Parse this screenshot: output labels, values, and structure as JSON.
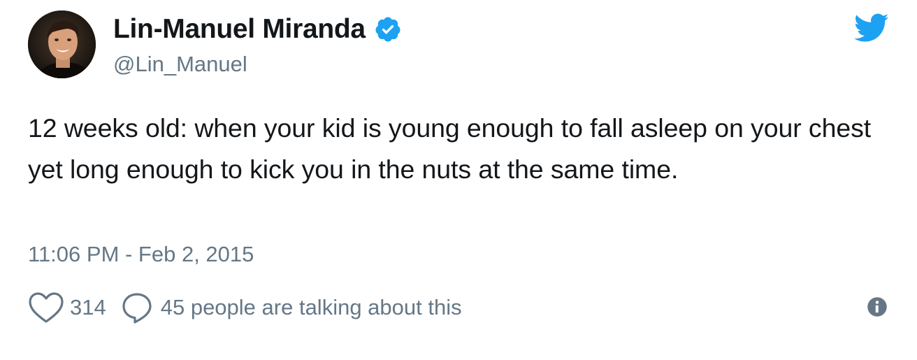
{
  "user": {
    "display_name": "Lin-Manuel Miranda",
    "handle": "@Lin_Manuel",
    "verified": true
  },
  "tweet": {
    "text": "12 weeks old: when your kid is young enough to fall asleep on your chest yet long enough to kick you in the nuts at the same time.",
    "timestamp": "11:06 PM - Feb 2, 2015"
  },
  "engagement": {
    "likes": "314",
    "conversation": "45 people are talking about this"
  },
  "icons": {
    "brand": "twitter-bird-icon",
    "verified": "verified-badge-icon",
    "like": "heart-icon",
    "reply": "speech-bubble-icon",
    "info": "info-icon"
  },
  "colors": {
    "brand_blue": "#1da1f2",
    "text_primary": "#14171a",
    "text_secondary": "#657786"
  }
}
